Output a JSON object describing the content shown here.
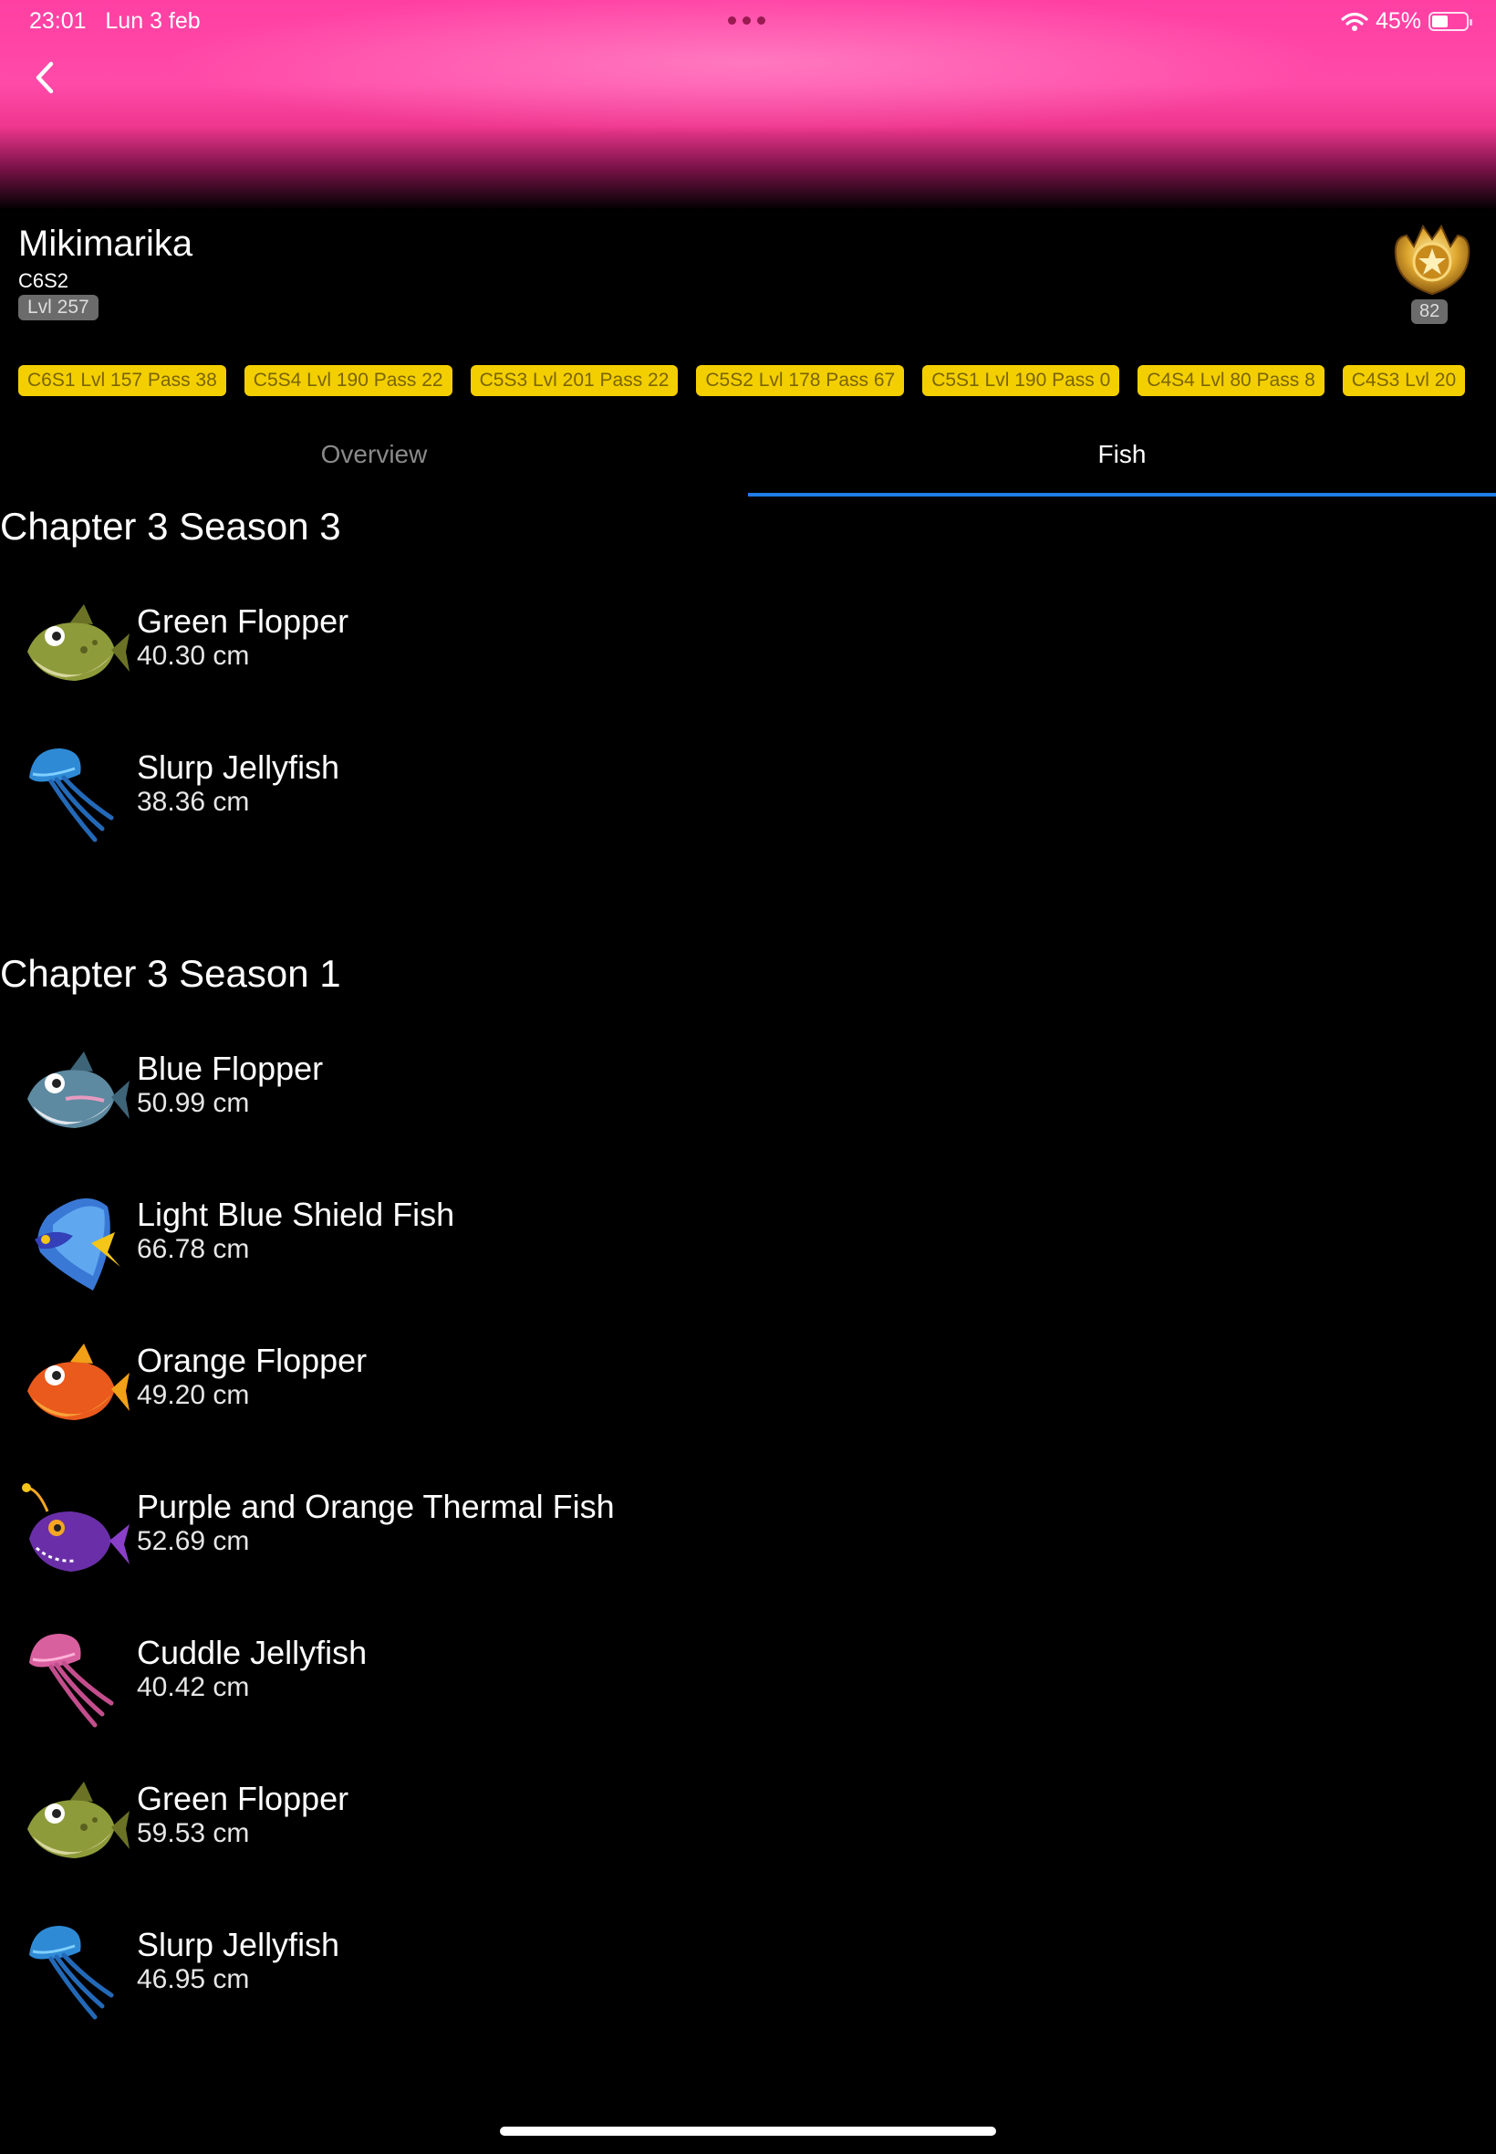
{
  "status_bar": {
    "time": "23:01",
    "date": "Lun 3 feb",
    "battery": "45%"
  },
  "profile": {
    "name": "Mikimarika",
    "season": "C6S2",
    "level": "Lvl 257",
    "crown_count": "82"
  },
  "season_chips": [
    "C6S1 Lvl 157 Pass 38",
    "C5S4 Lvl 190 Pass 22",
    "C5S3 Lvl 201 Pass 22",
    "C5S2 Lvl 178 Pass 67",
    "C5S1 Lvl 190 Pass 0",
    "C4S4 Lvl 80 Pass 8",
    "C4S3 Lvl 20"
  ],
  "tabs": {
    "overview": "Overview",
    "fish": "Fish",
    "active": "fish"
  },
  "sections": [
    {
      "title": "Chapter 3 Season 3",
      "items": [
        {
          "name": "Green Flopper",
          "size": "40.30 cm",
          "icon": "green-flopper-icon"
        },
        {
          "name": "Slurp Jellyfish",
          "size": "38.36 cm",
          "icon": "slurp-jellyfish-icon"
        }
      ]
    },
    {
      "title": "Chapter 3 Season 1",
      "items": [
        {
          "name": "Blue Flopper",
          "size": "50.99 cm",
          "icon": "blue-flopper-icon"
        },
        {
          "name": "Light Blue Shield Fish",
          "size": "66.78 cm",
          "icon": "shield-fish-icon"
        },
        {
          "name": "Orange Flopper",
          "size": "49.20 cm",
          "icon": "orange-flopper-icon"
        },
        {
          "name": "Purple and Orange Thermal Fish",
          "size": "52.69 cm",
          "icon": "thermal-fish-icon"
        },
        {
          "name": "Cuddle Jellyfish",
          "size": "40.42 cm",
          "icon": "cuddle-jellyfish-icon"
        },
        {
          "name": "Green Flopper",
          "size": "59.53 cm",
          "icon": "green-flopper-icon"
        },
        {
          "name": "Slurp Jellyfish",
          "size": "46.95 cm",
          "icon": "slurp-jellyfish-icon"
        }
      ]
    }
  ],
  "colors": {
    "accent": "#1f7de6",
    "chip": "#f4cf00",
    "hero": "#ff4aa8"
  }
}
